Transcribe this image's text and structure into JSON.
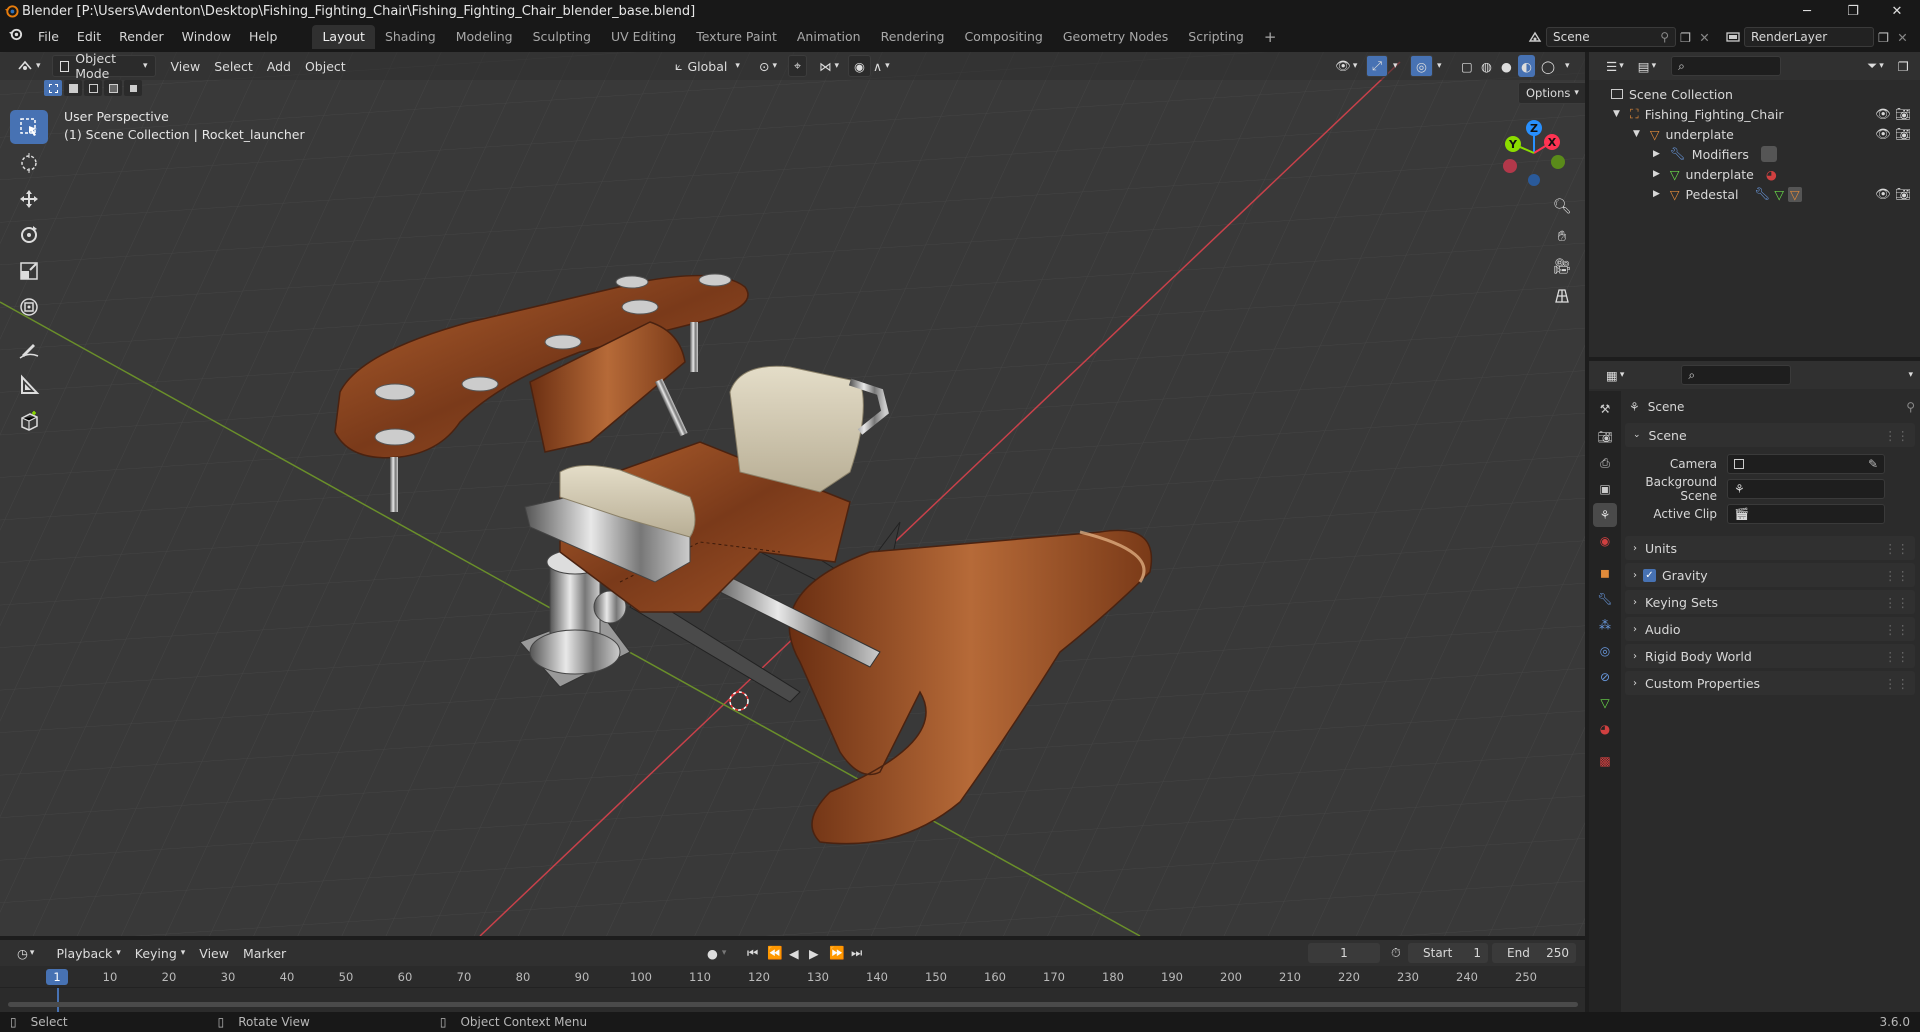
{
  "window": {
    "title": "Blender [P:\\Users\\Avdenton\\Desktop\\Fishing_Fighting_Chair\\Fishing_Fighting_Chair_blender_base.blend]",
    "minimize": "─",
    "maximize": "❐",
    "close": "✕"
  },
  "menu": {
    "items": [
      "File",
      "Edit",
      "Render",
      "Window",
      "Help"
    ]
  },
  "workspaces": {
    "tabs": [
      "Layout",
      "Shading",
      "Modeling",
      "Sculpting",
      "UV Editing",
      "Texture Paint",
      "Animation",
      "Rendering",
      "Compositing",
      "Geometry Nodes",
      "Scripting"
    ],
    "add": "+"
  },
  "scene_selector": {
    "value": "Scene"
  },
  "render_layer": {
    "value": "RenderLayer"
  },
  "viewport": {
    "mode": "Object Mode",
    "menus": [
      "View",
      "Select",
      "Add",
      "Object"
    ],
    "transform_orientation": "Global",
    "options": "Options",
    "overlay_line1": "User Perspective",
    "overlay_line2": "(1) Scene Collection | Rocket_launcher",
    "gizmo": {
      "x": "X",
      "y": "Y",
      "z": "Z"
    }
  },
  "outliner": {
    "rows": [
      {
        "label": "Scene Collection"
      },
      {
        "label": "Fishing_Fighting_Chair"
      },
      {
        "label": "underplate"
      },
      {
        "label": "Modifiers"
      },
      {
        "label": "underplate"
      },
      {
        "label": "Pedestal"
      }
    ]
  },
  "properties": {
    "context_title": "Scene",
    "section": "Scene",
    "fields": [
      {
        "label": "Camera",
        "value": ""
      },
      {
        "label": "Background Scene",
        "value": ""
      },
      {
        "label": "Active Clip",
        "value": ""
      }
    ],
    "panels": [
      "Units",
      "Gravity",
      "Keying Sets",
      "Audio",
      "Rigid Body World",
      "Custom Properties"
    ],
    "gravity_checked": true
  },
  "timeline": {
    "menus": [
      "Playback",
      "Keying",
      "View",
      "Marker"
    ],
    "current_frame": "1",
    "start_label": "Start",
    "start": "1",
    "end_label": "End",
    "end": "250",
    "ruler": [
      "10",
      "20",
      "30",
      "40",
      "50",
      "60",
      "70",
      "80",
      "90",
      "100",
      "110",
      "120",
      "130",
      "140",
      "150",
      "160",
      "170",
      "180",
      "190",
      "200",
      "210",
      "220",
      "230",
      "240",
      "250"
    ],
    "playhead": "1"
  },
  "status": {
    "select": "Select",
    "rotate": "Rotate View",
    "context": "Object Context Menu",
    "version": "3.6.0"
  },
  "colors": {
    "accent": "#4772b3",
    "x_axis": "#ff3352",
    "y_axis": "#8bdc00",
    "z_axis": "#2890ff",
    "wood": "#8a4420",
    "cushion": "#d6cdb6"
  }
}
